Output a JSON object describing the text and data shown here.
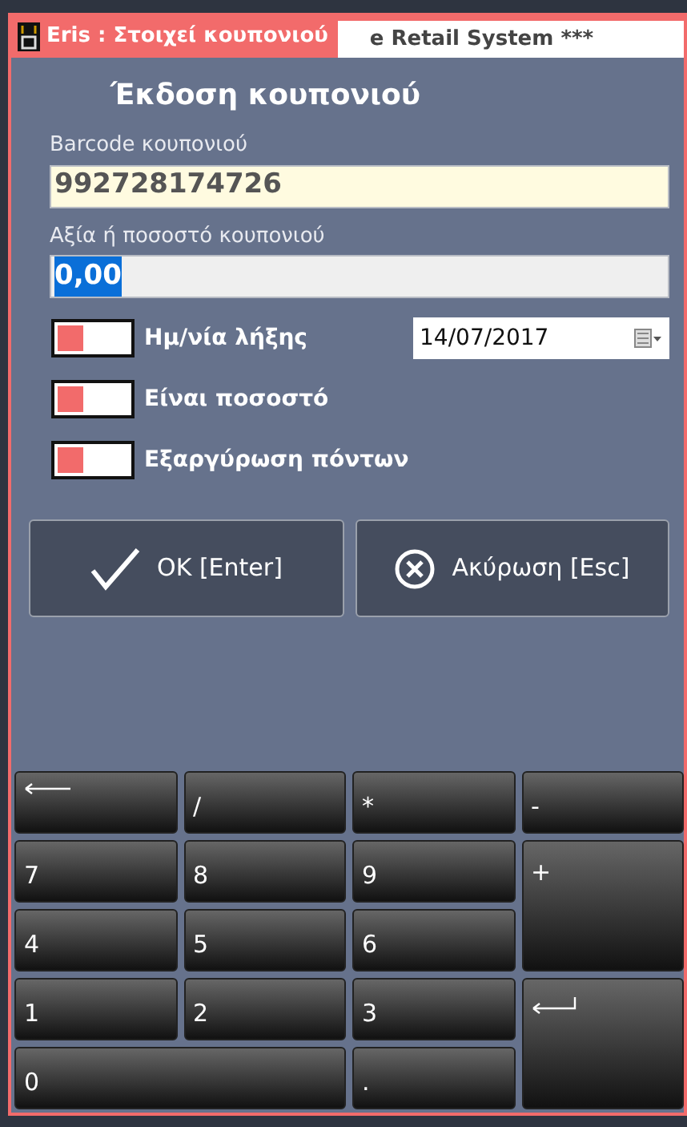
{
  "window": {
    "title": "Eris : Στοιχεί κουπονιού",
    "background_tab": "e Retail System ***"
  },
  "heading": "Έκδοση κουπονιού",
  "fields": [
    {
      "label": "Barcode κουπονιού",
      "value": "992728174726",
      "kind": "barcode"
    },
    {
      "label": "Αξία ή ποσοστό κουπονιού",
      "value": "0,00",
      "kind": "selected"
    }
  ],
  "toggles": [
    {
      "label": "Ημ/νία λήξης",
      "on": false
    },
    {
      "label": "Είναι ποσοστό",
      "on": false
    },
    {
      "label": "Εξαργύρωση πόντων",
      "on": false
    }
  ],
  "expiry_date": "14/07/2017",
  "buttons": [
    {
      "label": "OK [Enter]",
      "kind": "ok"
    },
    {
      "label": "Ακύρωση [Esc]",
      "kind": "cancel"
    }
  ],
  "keypad": [
    {
      "kind": "backspace"
    },
    {
      "kind": "key",
      "label": "/"
    },
    {
      "kind": "key",
      "label": "*"
    },
    {
      "kind": "key",
      "label": "-"
    },
    {
      "kind": "key",
      "label": "7"
    },
    {
      "kind": "key",
      "label": "8"
    },
    {
      "kind": "key",
      "label": "9"
    },
    {
      "kind": "tall",
      "label": "+"
    },
    {
      "kind": "key",
      "label": "4"
    },
    {
      "kind": "key",
      "label": "5"
    },
    {
      "kind": "key",
      "label": "6"
    },
    {
      "kind": "key",
      "label": "1"
    },
    {
      "kind": "key",
      "label": "2"
    },
    {
      "kind": "key",
      "label": "3"
    },
    {
      "kind": "enter"
    },
    {
      "kind": "wide",
      "label": "0"
    },
    {
      "kind": "key",
      "label": "."
    }
  ]
}
